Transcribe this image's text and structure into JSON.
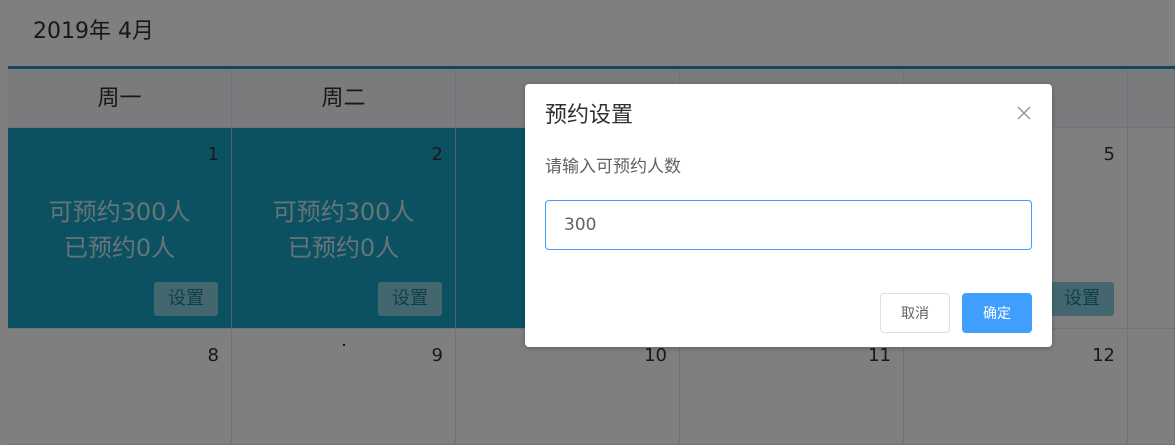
{
  "calendar": {
    "title": "2019年 4月",
    "weekdays": [
      "周一",
      "周二"
    ],
    "days": [
      {
        "number": "1",
        "capacity": "可预约300人",
        "booked": "已预约0人",
        "set_label": "设置"
      },
      {
        "number": "2",
        "capacity": "可预约300人",
        "booked": "已预约0人",
        "set_label": "设置"
      },
      {
        "number": "5",
        "set_label": "设置"
      },
      {
        "number": "8"
      },
      {
        "number": "9"
      },
      {
        "number": "10"
      },
      {
        "number": "11"
      },
      {
        "number": "12"
      }
    ]
  },
  "dialog": {
    "title": "预约设置",
    "label": "请输入可预约人数",
    "input_value": "300",
    "cancel_label": "取消",
    "confirm_label": "确定"
  },
  "colors": {
    "booked_cell": "#16a3c4",
    "header_rule": "#1f8fc2",
    "primary_button": "#409eff"
  },
  "icons": {
    "close": "close-icon"
  }
}
